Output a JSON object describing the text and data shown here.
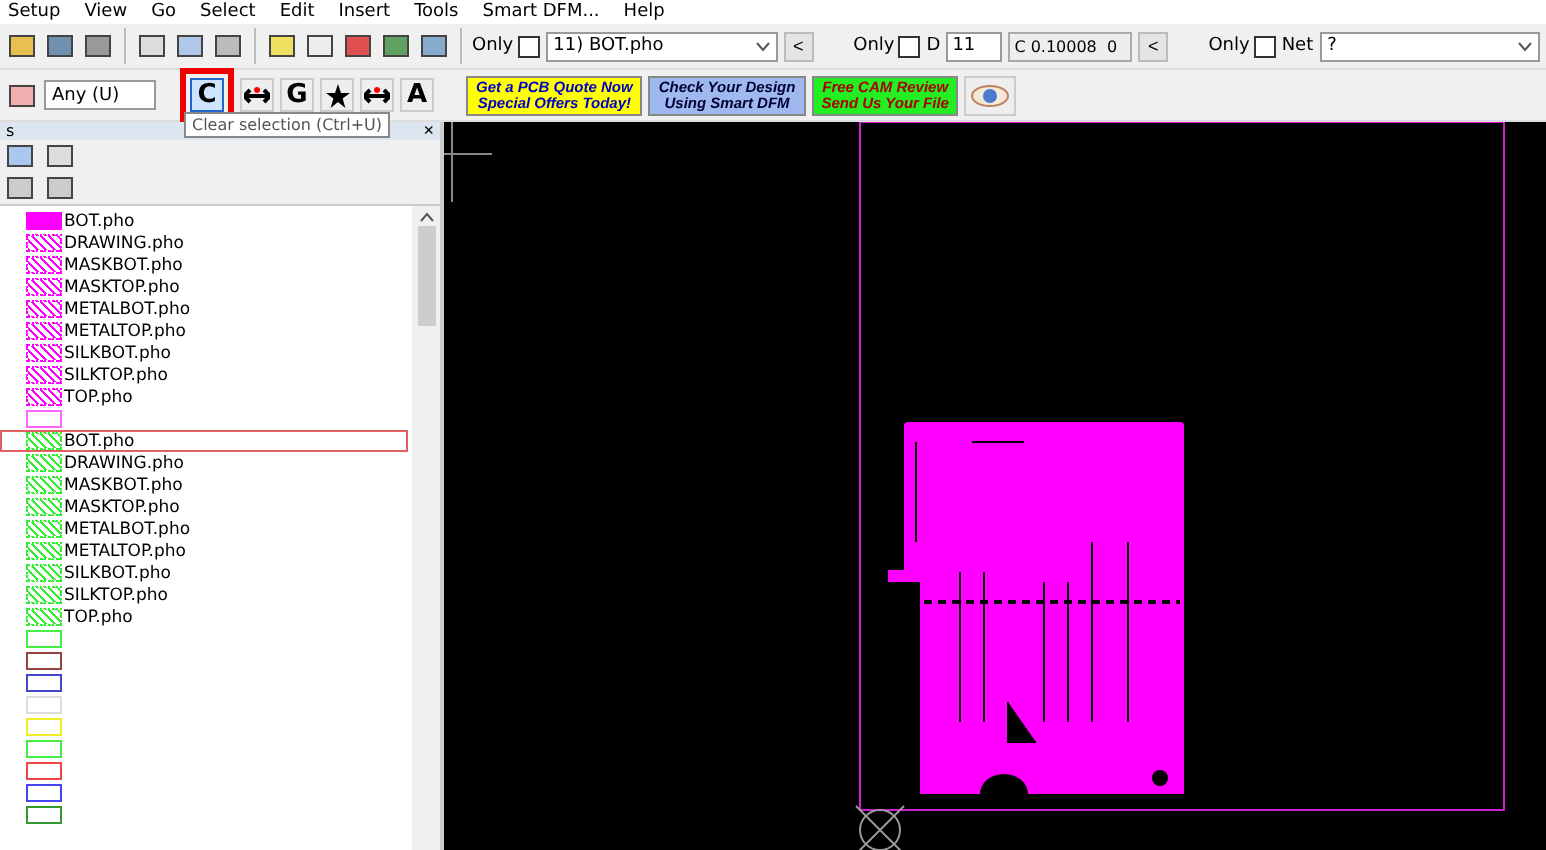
{
  "menu": [
    "Setup",
    "View",
    "Go",
    "Select",
    "Edit",
    "Insert",
    "Tools",
    "Smart DFM...",
    "Help"
  ],
  "toolbar1": {
    "layer_only": {
      "label": "Only",
      "checked": false
    },
    "layer_select": "11) BOT.pho",
    "dcode_only": {
      "label": "Only",
      "checked": false
    },
    "dcode_label": "D",
    "dcode_value": "11",
    "dcode_readout": "C 0.10008  0",
    "net_only": {
      "label": "Only",
      "checked": false
    },
    "net_label": "Net",
    "net_select": "?",
    "prev_button": "<"
  },
  "toolbar2": {
    "filter_select": "Any   (U)",
    "tools": [
      {
        "glyph": "C",
        "kind": "letter",
        "selected": true
      },
      {
        "kind": "arrows",
        "selected": false
      },
      {
        "glyph": "G",
        "kind": "letter",
        "selected": false
      },
      {
        "kind": "star",
        "selected": false
      },
      {
        "kind": "arrows",
        "selected": false
      },
      {
        "glyph": "A",
        "kind": "letter",
        "selected": false
      }
    ],
    "banners": [
      {
        "lines": [
          "Get a PCB Quote Now",
          "Special Offers Today!"
        ],
        "color": "#ffff00",
        "kind": "quote"
      },
      {
        "lines": [
          "Check Your Design",
          "Using Smart DFM"
        ],
        "color": "#a0b8f0",
        "kind": "dfm"
      },
      {
        "lines": [
          "Free CAM Review",
          "Send Us Your File"
        ],
        "color": "#22ee22",
        "kind": "cam"
      }
    ],
    "tooltip": "Clear selection (Ctrl+U)"
  },
  "panel": {
    "title": "s",
    "close": "×",
    "layers": [
      {
        "name": "BOT.pho",
        "color": "#ff00ff",
        "kind": "solid",
        "selected": false
      },
      {
        "name": "DRAWING.pho",
        "color": "#ff00ff",
        "kind": "hatched",
        "selected": false
      },
      {
        "name": "MASKBOT.pho",
        "color": "#ff00ff",
        "kind": "hatched",
        "selected": false
      },
      {
        "name": "MASKTOP.pho",
        "color": "#ff00ff",
        "kind": "hatched",
        "selected": false
      },
      {
        "name": "METALBOT.pho",
        "color": "#ff00ff",
        "kind": "hatched",
        "selected": false
      },
      {
        "name": "METALTOP.pho",
        "color": "#ff00ff",
        "kind": "hatched",
        "selected": false
      },
      {
        "name": "SILKBOT.pho",
        "color": "#ff00ff",
        "kind": "hatched",
        "selected": false
      },
      {
        "name": "SILKTOP.pho",
        "color": "#ff00ff",
        "kind": "hatched",
        "selected": false
      },
      {
        "name": "TOP.pho",
        "color": "#ff00ff",
        "kind": "hatched",
        "selected": false
      },
      {
        "color": "#ff66ff",
        "kind": "empty",
        "selected": false
      },
      {
        "name": "BOT.pho",
        "color": "#33ee33",
        "kind": "hatched",
        "selected": true
      },
      {
        "name": "DRAWING.pho",
        "color": "#33ee33",
        "kind": "hatched",
        "selected": false
      },
      {
        "name": "MASKBOT.pho",
        "color": "#33ee33",
        "kind": "hatched",
        "selected": false
      },
      {
        "name": "MASKTOP.pho",
        "color": "#33ee33",
        "kind": "hatched",
        "selected": false
      },
      {
        "name": "METALBOT.pho",
        "color": "#33ee33",
        "kind": "hatched",
        "selected": false
      },
      {
        "name": "METALTOP.pho",
        "color": "#33ee33",
        "kind": "hatched",
        "selected": false
      },
      {
        "name": "SILKBOT.pho",
        "color": "#33ee33",
        "kind": "hatched",
        "selected": false
      },
      {
        "name": "SILKTOP.pho",
        "color": "#33ee33",
        "kind": "hatched",
        "selected": false
      },
      {
        "name": "TOP.pho",
        "color": "#33ee33",
        "kind": "hatched",
        "selected": false
      },
      {
        "color": "#44ee44",
        "kind": "empty",
        "selected": false
      },
      {
        "color": "#994444",
        "kind": "empty",
        "selected": false
      },
      {
        "color": "#4444cc",
        "kind": "empty",
        "selected": false
      },
      {
        "color": "#dddddd",
        "kind": "empty",
        "selected": false
      },
      {
        "color": "#eeee22",
        "kind": "empty",
        "selected": false
      },
      {
        "color": "#44ee44",
        "kind": "empty",
        "selected": false
      },
      {
        "color": "#ee4444",
        "kind": "empty",
        "selected": false
      },
      {
        "color": "#4444ee",
        "kind": "empty",
        "selected": false
      },
      {
        "color": "#339933",
        "kind": "empty",
        "selected": false
      }
    ]
  }
}
